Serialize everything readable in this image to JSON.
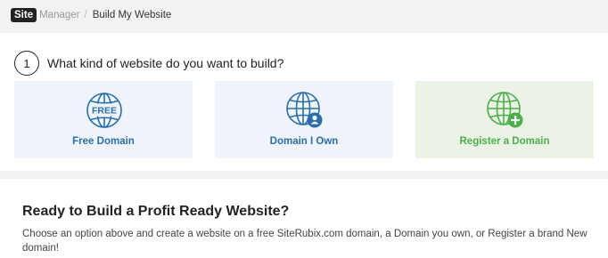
{
  "breadcrumb": {
    "logo_box": "Site",
    "logo_text": "Manager",
    "separator": "/",
    "current": "Build My Website"
  },
  "step": {
    "number": "1",
    "question": "What kind of website do you want to build?"
  },
  "options": [
    {
      "label": "Free Domain",
      "icon": "globe-free-icon",
      "color": "#2b6ea8"
    },
    {
      "label": "Domain I Own",
      "icon": "globe-user-icon",
      "color": "#2b6ea8"
    },
    {
      "label": "Register a Domain",
      "icon": "globe-plus-icon",
      "color": "#4cae4c"
    }
  ],
  "globe_badge_text": "FREE",
  "footer": {
    "title": "Ready to Build a Profit Ready Website?",
    "description": "Choose an option above and create a website on a free SiteRubix.com domain, a Domain you own, or Register a brand New domain!"
  }
}
